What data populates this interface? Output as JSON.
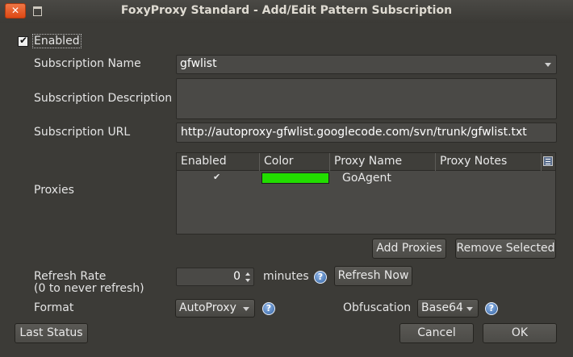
{
  "window": {
    "title": "FoxyProxy Standard - Add/Edit Pattern Subscription",
    "close_glyph": "✕"
  },
  "enabled": {
    "label": "Enabled",
    "checked": true
  },
  "subscription_name": {
    "label": "Subscription Name",
    "value": "gfwlist"
  },
  "subscription_description": {
    "label": "Subscription Description",
    "value": ""
  },
  "subscription_url": {
    "label": "Subscription URL",
    "value": "http://autoproxy-gfwlist.googlecode.com/svn/trunk/gfwlist.txt"
  },
  "proxies": {
    "label": "Proxies",
    "columns": [
      "Enabled",
      "Color",
      "Proxy Name",
      "Proxy Notes"
    ],
    "rows": [
      {
        "enabled": "✔",
        "color": "#22dd00",
        "name": "GoAgent",
        "notes": ""
      }
    ],
    "add_label": "Add Proxies",
    "remove_label": "Remove Selected"
  },
  "refresh": {
    "label": "Refresh Rate",
    "sublabel": "(0 to never refresh)",
    "value": "0",
    "unit": "minutes",
    "refresh_now_label": "Refresh Now"
  },
  "format": {
    "label": "Format",
    "value": "AutoProxy"
  },
  "obfuscation": {
    "label": "Obfuscation",
    "value": "Base64"
  },
  "buttons": {
    "last_status": "Last Status",
    "cancel": "Cancel",
    "ok": "OK"
  },
  "help_glyph": "?"
}
